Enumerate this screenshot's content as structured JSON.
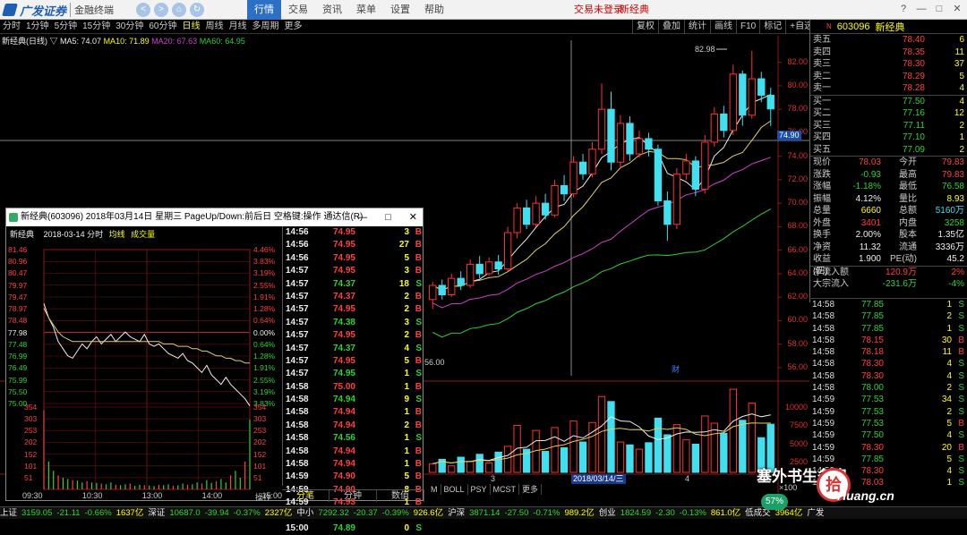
{
  "app": {
    "brand": "广发证券",
    "product": "金融终端",
    "nav_back": "<",
    "nav_fwd": ">",
    "nav_home": "⌂",
    "nav_refresh": "↻"
  },
  "menu": [
    "行情",
    "交易",
    "资讯",
    "菜单",
    "设置",
    "帮助"
  ],
  "login_text": "交易未登录",
  "top_stock_name": "新经典",
  "window_controls": [
    "?",
    "—",
    "□",
    "✕"
  ],
  "periods": [
    "分时",
    "1分钟",
    "5分钟",
    "15分钟",
    "30分钟",
    "60分钟",
    "日线",
    "周线",
    "月线",
    "多周期",
    "更多"
  ],
  "active_period": "日线",
  "right_tools": [
    "复权",
    "叠加",
    "统计",
    "画线",
    "F10",
    "标记",
    "+自选",
    "返回"
  ],
  "chart_info": {
    "title": "新经典(日线) ▽",
    "ma5": "MA5: 74.07",
    "ma10": "MA10: 71.89",
    "ma20": "MA20: 67.63",
    "ma60": "MA60: 64.95"
  },
  "price_axis": [
    "82.00",
    "80.00",
    "78.00",
    "76.00",
    "74.00",
    "72.00",
    "70.00",
    "68.00",
    "66.00",
    "64.00",
    "62.00",
    "60.00",
    "58.00",
    "56.00"
  ],
  "current_price_tag": "74.90",
  "high_label": "82.98",
  "low_label": "56.00",
  "volume_axis": [
    "10000",
    "7500",
    "5000",
    "2500"
  ],
  "volume_unit": "×100",
  "cai_marker": "财",
  "x_markers": {
    "m3": "3",
    "m4": "4"
  },
  "date_label": "2018/03/14/三",
  "bottom_tabs": [
    "M",
    "BOLL",
    "PSY",
    "MCST",
    "更多"
  ],
  "ops_tab": "操作",
  "quote": {
    "code": "603096",
    "name": "新经典",
    "prefix": "N",
    "asks": [
      {
        "label": "卖五",
        "price": "78.40",
        "vol": "6"
      },
      {
        "label": "卖四",
        "price": "78.35",
        "vol": "11"
      },
      {
        "label": "卖三",
        "price": "78.30",
        "vol": "37"
      },
      {
        "label": "卖二",
        "price": "78.29",
        "vol": "5"
      },
      {
        "label": "卖一",
        "price": "78.28",
        "vol": "4"
      }
    ],
    "bids": [
      {
        "label": "买一",
        "price": "77.50",
        "vol": "4"
      },
      {
        "label": "买二",
        "price": "77.16",
        "vol": "12"
      },
      {
        "label": "买三",
        "price": "77.11",
        "vol": "2"
      },
      {
        "label": "买四",
        "price": "77.10",
        "vol": "1"
      },
      {
        "label": "买五",
        "price": "77.09",
        "vol": "2"
      }
    ],
    "stats": [
      {
        "l1": "现价",
        "v1": "78.03",
        "c1": "red",
        "l2": "今开",
        "v2": "79.83",
        "c2": "red"
      },
      {
        "l1": "涨跌",
        "v1": "-0.93",
        "c1": "grn",
        "l2": "最高",
        "v2": "79.83",
        "c2": "red"
      },
      {
        "l1": "涨幅",
        "v1": "-1.18%",
        "c1": "grn",
        "l2": "最低",
        "v2": "76.58",
        "c2": "grn"
      },
      {
        "l1": "振幅",
        "v1": "4.12%",
        "c1": "wht",
        "l2": "量比",
        "v2": "8.93",
        "c2": "yel"
      },
      {
        "l1": "总量",
        "v1": "6660",
        "c1": "yel",
        "l2": "总额",
        "v2": "5160万",
        "c2": "cyn"
      },
      {
        "l1": "外盘",
        "v1": "3401",
        "c1": "red",
        "l2": "内盘",
        "v2": "3258",
        "c2": "grn"
      },
      {
        "l1": "换手",
        "v1": "2.00%",
        "c1": "wht",
        "l2": "股本",
        "v2": "1.35亿",
        "c2": "wht"
      },
      {
        "l1": "净资",
        "v1": "11.32",
        "c1": "wht",
        "l2": "流通",
        "v2": "3336万",
        "c2": "wht"
      },
      {
        "l1": "收益(四)",
        "v1": "1.900",
        "c1": "wht",
        "l2": "PE(动)",
        "v2": "45.2",
        "c2": "wht"
      }
    ],
    "flows": [
      {
        "label": "净流入额",
        "value": "120.9万",
        "pct": "2%",
        "color": "red"
      },
      {
        "label": "大宗流入",
        "value": "-231.6万",
        "pct": "-4%",
        "color": "grn"
      }
    ],
    "ticks": [
      {
        "t": "14:58",
        "p": "77.85",
        "v": "1",
        "d": "S"
      },
      {
        "t": "14:58",
        "p": "77.85",
        "v": "2",
        "d": "S"
      },
      {
        "t": "14:58",
        "p": "77.85",
        "v": "1",
        "d": "S"
      },
      {
        "t": "14:58",
        "p": "78.15",
        "v": "30",
        "d": "B"
      },
      {
        "t": "14:58",
        "p": "78.18",
        "v": "11",
        "d": "B"
      },
      {
        "t": "14:58",
        "p": "78.30",
        "v": "4",
        "d": "S"
      },
      {
        "t": "14:58",
        "p": "78.30",
        "v": "4",
        "d": "S"
      },
      {
        "t": "14:58",
        "p": "78.00",
        "v": "2",
        "d": "S"
      },
      {
        "t": "14:59",
        "p": "77.53",
        "v": "34",
        "d": "S"
      },
      {
        "t": "14:59",
        "p": "77.53",
        "v": "2",
        "d": "S"
      },
      {
        "t": "14:59",
        "p": "77.53",
        "v": "5",
        "d": "B"
      },
      {
        "t": "14:59",
        "p": "77.50",
        "v": "4",
        "d": "S"
      },
      {
        "t": "14:59",
        "p": "78.30",
        "v": "20",
        "d": "B"
      },
      {
        "t": "14:59",
        "p": "77.85",
        "v": "5",
        "d": "S"
      },
      {
        "t": "14:59",
        "p": "78.30",
        "v": "4",
        "d": "S"
      },
      {
        "t": "15:00",
        "p": "78.03",
        "v": "1",
        "d": "S"
      }
    ]
  },
  "popup": {
    "title": "新经典(603096) 2018年03月14日 星期三 PageUp/Down:前后日 空格键:操作 通达信(R)",
    "ctrls": [
      "—",
      "□",
      "✕"
    ],
    "info_name": "新经典",
    "info_date": "2018-03-14 分时",
    "info_avg": "均线",
    "info_vol": "成交量",
    "price_labels": [
      "81.46",
      "80.96",
      "80.47",
      "79.97",
      "79.47",
      "78.97",
      "78.48",
      "77.98",
      "77.48",
      "76.99",
      "76.49",
      "75.99",
      "75.50",
      "75.00"
    ],
    "pct_labels": [
      "4.46%",
      "3.83%",
      "3.19%",
      "2.55%",
      "1.91%",
      "1.28%",
      "0.64%",
      "0.00%",
      "0.64%",
      "1.28%",
      "1.91%",
      "2.55%",
      "3.19%",
      "3.83%"
    ],
    "vol_labels": [
      "354",
      "303",
      "253",
      "202",
      "152",
      "101",
      "51"
    ],
    "times": [
      "09:30",
      "10:30",
      "13:00",
      "14:00",
      "15:00"
    ],
    "op_label": "操作",
    "tabs": [
      "分笔",
      "分钟",
      "数值"
    ],
    "ticks": [
      {
        "t": "14:56",
        "p": "74.95",
        "v": "3",
        "d": "B"
      },
      {
        "t": "14:56",
        "p": "74.95",
        "v": "27",
        "d": "B"
      },
      {
        "t": "14:56",
        "p": "74.95",
        "v": "5",
        "d": "B"
      },
      {
        "t": "14:57",
        "p": "74.95",
        "v": "3",
        "d": "B"
      },
      {
        "t": "14:57",
        "p": "74.37",
        "v": "18",
        "d": "S"
      },
      {
        "t": "14:57",
        "p": "74.37",
        "v": "2",
        "d": "B"
      },
      {
        "t": "14:57",
        "p": "74.95",
        "v": "2",
        "d": "B"
      },
      {
        "t": "14:57",
        "p": "74.38",
        "v": "3",
        "d": "S"
      },
      {
        "t": "14:57",
        "p": "74.95",
        "v": "2",
        "d": "B"
      },
      {
        "t": "14:57",
        "p": "74.37",
        "v": "4",
        "d": "S"
      },
      {
        "t": "14:57",
        "p": "74.95",
        "v": "5",
        "d": "B"
      },
      {
        "t": "14:57",
        "p": "74.95",
        "v": "1",
        "d": "S"
      },
      {
        "t": "14:58",
        "p": "75.00",
        "v": "1",
        "d": "B"
      },
      {
        "t": "14:58",
        "p": "74.94",
        "v": "9",
        "d": "S"
      },
      {
        "t": "14:58",
        "p": "74.94",
        "v": "1",
        "d": "B"
      },
      {
        "t": "14:58",
        "p": "74.94",
        "v": "2",
        "d": "B"
      },
      {
        "t": "14:58",
        "p": "74.56",
        "v": "1",
        "d": "S"
      },
      {
        "t": "14:58",
        "p": "74.94",
        "v": "1",
        "d": "B"
      },
      {
        "t": "14:58",
        "p": "74.94",
        "v": "1",
        "d": "B"
      },
      {
        "t": "14:59",
        "p": "74.90",
        "v": "5",
        "d": "B"
      },
      {
        "t": "14:59",
        "p": "74.90",
        "v": "8",
        "d": "B"
      },
      {
        "t": "14:59",
        "p": "74.93",
        "v": "1",
        "d": "B"
      },
      {
        "t": "14:59",
        "p": "74.93",
        "v": "1",
        "d": "B"
      },
      {
        "t": "15:00",
        "p": "74.89",
        "v": "0",
        "d": "S"
      }
    ]
  },
  "statusbar": [
    {
      "text": "上证",
      "c": "wht"
    },
    {
      "text": "3159.05",
      "c": "grn"
    },
    {
      "text": "-21.11",
      "c": "grn"
    },
    {
      "text": "-0.66%",
      "c": "grn"
    },
    {
      "text": "1637亿",
      "c": "yel"
    },
    {
      "text": "深证",
      "c": "wht"
    },
    {
      "text": "10687.0",
      "c": "grn"
    },
    {
      "text": "-39.94",
      "c": "grn"
    },
    {
      "text": "-0.37%",
      "c": "grn"
    },
    {
      "text": "2327亿",
      "c": "yel"
    },
    {
      "text": "中小",
      "c": "wht"
    },
    {
      "text": "7292.32",
      "c": "grn"
    },
    {
      "text": "-20.37",
      "c": "grn"
    },
    {
      "text": "-0.39%",
      "c": "grn"
    },
    {
      "text": "926.6亿",
      "c": "yel"
    },
    {
      "text": "沪深",
      "c": "wht"
    },
    {
      "text": "3871.14",
      "c": "grn"
    },
    {
      "text": "-27.50",
      "c": "grn"
    },
    {
      "text": "-0.71%",
      "c": "grn"
    },
    {
      "text": "989.2亿",
      "c": "yel"
    },
    {
      "text": "创业",
      "c": "wht"
    },
    {
      "text": "1824.59",
      "c": "grn"
    },
    {
      "text": "-2.30",
      "c": "grn"
    },
    {
      "text": "-0.13%",
      "c": "grn"
    },
    {
      "text": "861.0亿",
      "c": "yel"
    },
    {
      "text": "低成交",
      "c": "wht"
    },
    {
      "text": "3964亿",
      "c": "yel"
    },
    {
      "text": "广发",
      "c": "wht"
    }
  ],
  "watermark": {
    "text": "塞外书生条泉",
    "site": "Huang.cn",
    "logo": "拾",
    "pct": "57%"
  },
  "chart_data": [
    {
      "type": "candlestick",
      "title": "新经典(日线)",
      "ylim": [
        55,
        83.5
      ],
      "candles": [
        {
          "o": 61.8,
          "c": 63.0,
          "h": 63.3,
          "l": 61.0
        },
        {
          "o": 63.0,
          "c": 62.2,
          "h": 63.5,
          "l": 61.8
        },
        {
          "o": 62.2,
          "c": 63.6,
          "h": 64.0,
          "l": 62.0
        },
        {
          "o": 63.6,
          "c": 63.0,
          "h": 64.2,
          "l": 62.6
        },
        {
          "o": 63.0,
          "c": 64.8,
          "h": 65.2,
          "l": 62.8
        },
        {
          "o": 64.8,
          "c": 64.0,
          "h": 65.5,
          "l": 63.6
        },
        {
          "o": 64.0,
          "c": 65.0,
          "h": 65.4,
          "l": 63.8
        },
        {
          "o": 65.0,
          "c": 64.4,
          "h": 65.6,
          "l": 63.9
        },
        {
          "o": 64.4,
          "c": 67.5,
          "h": 68.0,
          "l": 64.2
        },
        {
          "o": 67.5,
          "c": 69.6,
          "h": 70.0,
          "l": 67.0
        },
        {
          "o": 69.6,
          "c": 68.2,
          "h": 70.3,
          "l": 67.8
        },
        {
          "o": 68.2,
          "c": 70.0,
          "h": 70.6,
          "l": 68.0
        },
        {
          "o": 70.0,
          "c": 69.0,
          "h": 70.8,
          "l": 68.6
        },
        {
          "o": 69.0,
          "c": 71.5,
          "h": 72.0,
          "l": 68.8
        },
        {
          "o": 71.5,
          "c": 70.8,
          "h": 72.4,
          "l": 70.2
        },
        {
          "o": 70.8,
          "c": 73.5,
          "h": 74.0,
          "l": 70.5
        },
        {
          "o": 73.5,
          "c": 72.5,
          "h": 74.2,
          "l": 72.0
        },
        {
          "o": 72.5,
          "c": 74.6,
          "h": 75.2,
          "l": 72.2
        },
        {
          "o": 74.6,
          "c": 78.0,
          "h": 80.2,
          "l": 74.2
        },
        {
          "o": 78.0,
          "c": 73.5,
          "h": 79.5,
          "l": 72.8
        },
        {
          "o": 73.5,
          "c": 76.8,
          "h": 77.5,
          "l": 73.0
        },
        {
          "o": 76.8,
          "c": 74.2,
          "h": 77.4,
          "l": 73.6
        },
        {
          "o": 74.2,
          "c": 75.5,
          "h": 76.2,
          "l": 73.9
        },
        {
          "o": 75.5,
          "c": 74.6,
          "h": 76.0,
          "l": 74.0
        },
        {
          "o": 74.6,
          "c": 70.2,
          "h": 75.0,
          "l": 69.8
        },
        {
          "o": 70.2,
          "c": 68.2,
          "h": 71.0,
          "l": 66.8
        },
        {
          "o": 68.2,
          "c": 72.5,
          "h": 73.0,
          "l": 67.8
        },
        {
          "o": 72.5,
          "c": 73.6,
          "h": 74.2,
          "l": 72.0
        },
        {
          "o": 73.6,
          "c": 71.2,
          "h": 74.0,
          "l": 70.6
        },
        {
          "o": 71.2,
          "c": 75.2,
          "h": 75.8,
          "l": 70.8
        },
        {
          "o": 75.2,
          "c": 77.6,
          "h": 78.2,
          "l": 74.8
        },
        {
          "o": 77.6,
          "c": 76.2,
          "h": 78.3,
          "l": 75.6
        },
        {
          "o": 76.2,
          "c": 81.0,
          "h": 81.8,
          "l": 75.8
        },
        {
          "o": 81.0,
          "c": 77.5,
          "h": 81.3,
          "l": 76.6
        },
        {
          "o": 77.5,
          "c": 80.6,
          "h": 82.98,
          "l": 77.2
        },
        {
          "o": 80.6,
          "c": 79.2,
          "h": 81.2,
          "l": 78.6
        },
        {
          "o": 79.2,
          "c": 78.03,
          "h": 79.83,
          "l": 76.58
        }
      ],
      "volume": [
        1200,
        1800,
        900,
        2100,
        1500,
        2500,
        1300,
        2800,
        3600,
        6500,
        3200,
        5800,
        2900,
        6200,
        3400,
        7100,
        4200,
        6900,
        10500,
        9800,
        4200,
        3800,
        3200,
        4100,
        7500,
        5200,
        6600,
        4500,
        3900,
        7800,
        6800,
        5400,
        11500,
        7200,
        9600,
        4800,
        6660
      ]
    },
    {
      "type": "line",
      "title": "新经典(603096) 2018年03月14日 分时",
      "ylim": [
        75.0,
        81.46
      ],
      "prev_close": 77.98,
      "price": [
        79.2,
        78.6,
        78.2,
        77.6,
        77.3,
        77.0,
        76.9,
        77.2,
        77.5,
        77.3,
        77.6,
        77.8,
        77.5,
        77.7,
        77.9,
        77.6,
        77.8,
        78.0,
        77.8,
        77.7,
        77.6,
        77.9,
        77.5,
        77.4,
        77.5,
        77.3,
        77.1,
        77.0,
        76.9,
        77.1,
        76.8,
        76.7,
        76.5,
        76.3,
        76.6,
        76.2,
        76.0,
        75.8,
        76.1,
        75.8,
        75.6,
        75.4,
        75.2,
        74.9
      ],
      "avg": [
        79.0,
        78.6,
        78.3,
        78.0,
        77.8,
        77.7,
        77.6,
        77.6,
        77.6,
        77.6,
        77.6,
        77.6,
        77.6,
        77.6,
        77.6,
        77.6,
        77.6,
        77.6,
        77.6,
        77.6,
        77.6,
        77.6,
        77.6,
        77.6,
        77.6,
        77.5,
        77.5,
        77.5,
        77.4,
        77.4,
        77.4,
        77.3,
        77.3,
        77.2,
        77.2,
        77.1,
        77.0,
        77.0,
        76.9,
        76.9,
        76.8,
        76.8,
        76.7,
        76.7
      ],
      "volume": [
        340,
        120,
        80,
        60,
        50,
        45,
        40,
        38,
        30,
        35,
        30,
        28,
        25,
        22,
        30,
        20,
        18,
        22,
        25,
        15,
        20,
        18,
        16,
        14,
        20,
        18,
        22,
        15,
        18,
        25,
        20,
        22,
        30,
        25,
        40,
        28,
        35,
        45,
        30,
        60,
        80,
        50,
        120,
        300
      ]
    }
  ]
}
